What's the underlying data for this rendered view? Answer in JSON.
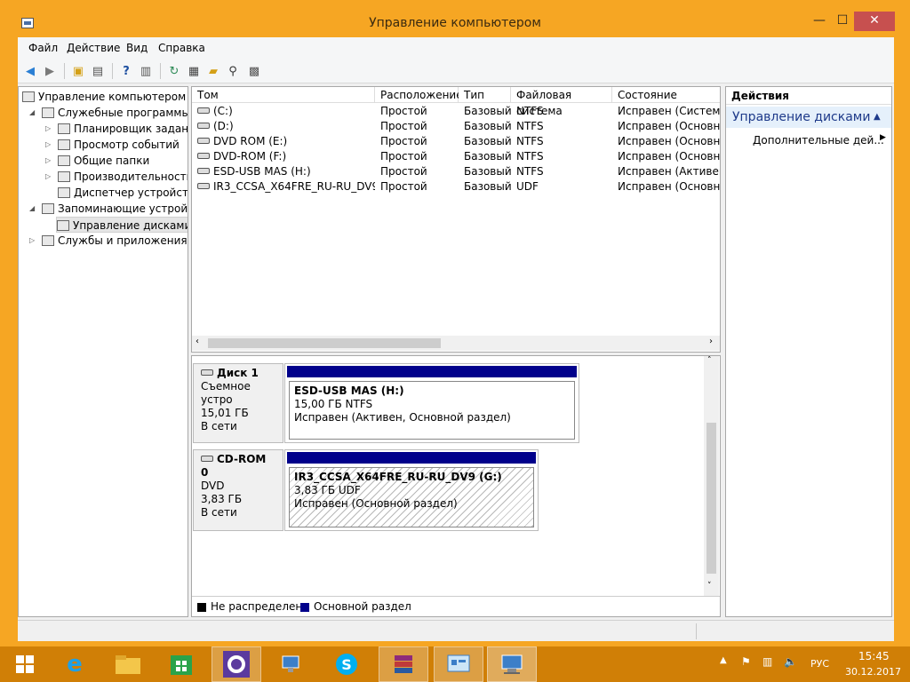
{
  "window": {
    "title": "Управление компьютером",
    "min_glyph": "—",
    "max_glyph": "☐",
    "close_glyph": "✕"
  },
  "menu": [
    "Файл",
    "Действие",
    "Вид",
    "Справка"
  ],
  "toolbar": {
    "icons": [
      "back-icon",
      "forward-icon",
      "up-folder-icon",
      "show-hide-tree-icon",
      "help-icon",
      "show-hide-action-pane-icon",
      "refresh-icon",
      "properties-icon",
      "open-folder-icon",
      "search-icon",
      "export-icon"
    ]
  },
  "tree": {
    "items": [
      {
        "label": "Управление компьютером (л",
        "icon": "computer-management-icon"
      },
      {
        "label": "Служебные программы",
        "icon": "tools-icon"
      },
      {
        "label": "Планировщик заданий",
        "icon": "clock-icon"
      },
      {
        "label": "Просмотр событий",
        "icon": "event-viewer-icon"
      },
      {
        "label": "Общие папки",
        "icon": "shared-folder-icon"
      },
      {
        "label": "Производительность",
        "icon": "performance-icon"
      },
      {
        "label": "Диспетчер устройств",
        "icon": "device-manager-icon"
      },
      {
        "label": "Запоминающие устройст",
        "icon": "storage-icon"
      },
      {
        "label": "Управление дисками",
        "icon": "disk-management-icon"
      },
      {
        "label": "Службы и приложения",
        "icon": "services-icon"
      }
    ]
  },
  "volumes": {
    "columns": [
      "Том",
      "Расположение",
      "Тип",
      "Файловая система",
      "Состояние"
    ],
    "rows": [
      [
        "(C:)",
        "Простой",
        "Базовый",
        "NTFS",
        "Исправен (Система,"
      ],
      [
        "(D:)",
        "Простой",
        "Базовый",
        "NTFS",
        "Исправен (Основной"
      ],
      [
        "DVD ROM (E:)",
        "Простой",
        "Базовый",
        "NTFS",
        "Исправен (Основной"
      ],
      [
        "DVD-ROM (F:)",
        "Простой",
        "Базовый",
        "NTFS",
        "Исправен (Основной"
      ],
      [
        "ESD-USB MAS (H:)",
        "Простой",
        "Базовый",
        "NTFS",
        "Исправен (Активен, ("
      ],
      [
        "IR3_CCSA_X64FRE_RU-RU_DV9 (G:)",
        "Простой",
        "Базовый",
        "UDF",
        "Исправен (Основной"
      ]
    ]
  },
  "disks": [
    {
      "name": "Диск 1",
      "type": "Съемное устро",
      "size": "15,01 ГБ",
      "status": "В сети",
      "partition": {
        "name": "ESD-USB MAS  (H:)",
        "size_fs": "15,00 ГБ NTFS",
        "state": "Исправен (Активен, Основной раздел)"
      }
    },
    {
      "name": "CD-ROM 0",
      "type": "DVD",
      "size": "3,83 ГБ",
      "status": "В сети",
      "partition": {
        "name": "IR3_CCSA_X64FRE_RU-RU_DV9  (G:)",
        "size_fs": "3,83 ГБ UDF",
        "state": "Исправен (Основной раздел)"
      }
    }
  ],
  "legend": {
    "unallocated": "Не распределена",
    "primary": "Основной раздел",
    "unallocated_color": "#000000",
    "primary_color": "#00008b"
  },
  "actions": {
    "header": "Действия",
    "selected": "Управление дисками",
    "more": "Дополнительные дей..."
  },
  "taskbar": {
    "apps": [
      "start-icon",
      "internet-explorer-icon",
      "file-explorer-icon",
      "store-icon",
      "settings-gear-icon",
      "network-icon",
      "skype-icon",
      "winrar-icon",
      "control-panel-icon",
      "computer-management-icon"
    ],
    "language": "РУС",
    "time": "15:45",
    "date": "30.12.2017"
  },
  "colors": {
    "window_frame": "#f6a623",
    "taskbar": "#d07f06",
    "close_button": "#c7504f",
    "partition_header": "#00008b"
  }
}
